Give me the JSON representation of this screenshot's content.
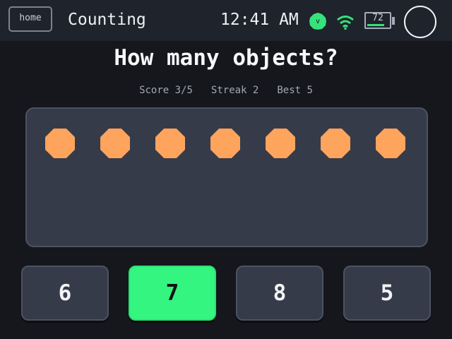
{
  "statusbar": {
    "home_label": "home",
    "app_title": "Counting",
    "time": "12:41 AM",
    "user_initial": "v",
    "battery_level": 72,
    "battery_label": "72",
    "colors": {
      "user_badge": "#35e27c",
      "wifi": "#35e27c",
      "battery_fill": "#34e07a"
    },
    "icons": [
      "home-button",
      "user-badge-icon",
      "wifi-icon",
      "battery-icon",
      "power-circle-icon"
    ]
  },
  "quiz": {
    "question": "How many objects?",
    "score": "Score 3/5",
    "streak": "Streak 2",
    "best": "Best 5",
    "object_count": 7,
    "object_color": "#ffa45c",
    "answers": [
      "6",
      "7",
      "8",
      "5"
    ],
    "selected_answer": "7",
    "selected_color": "#33f57f"
  }
}
